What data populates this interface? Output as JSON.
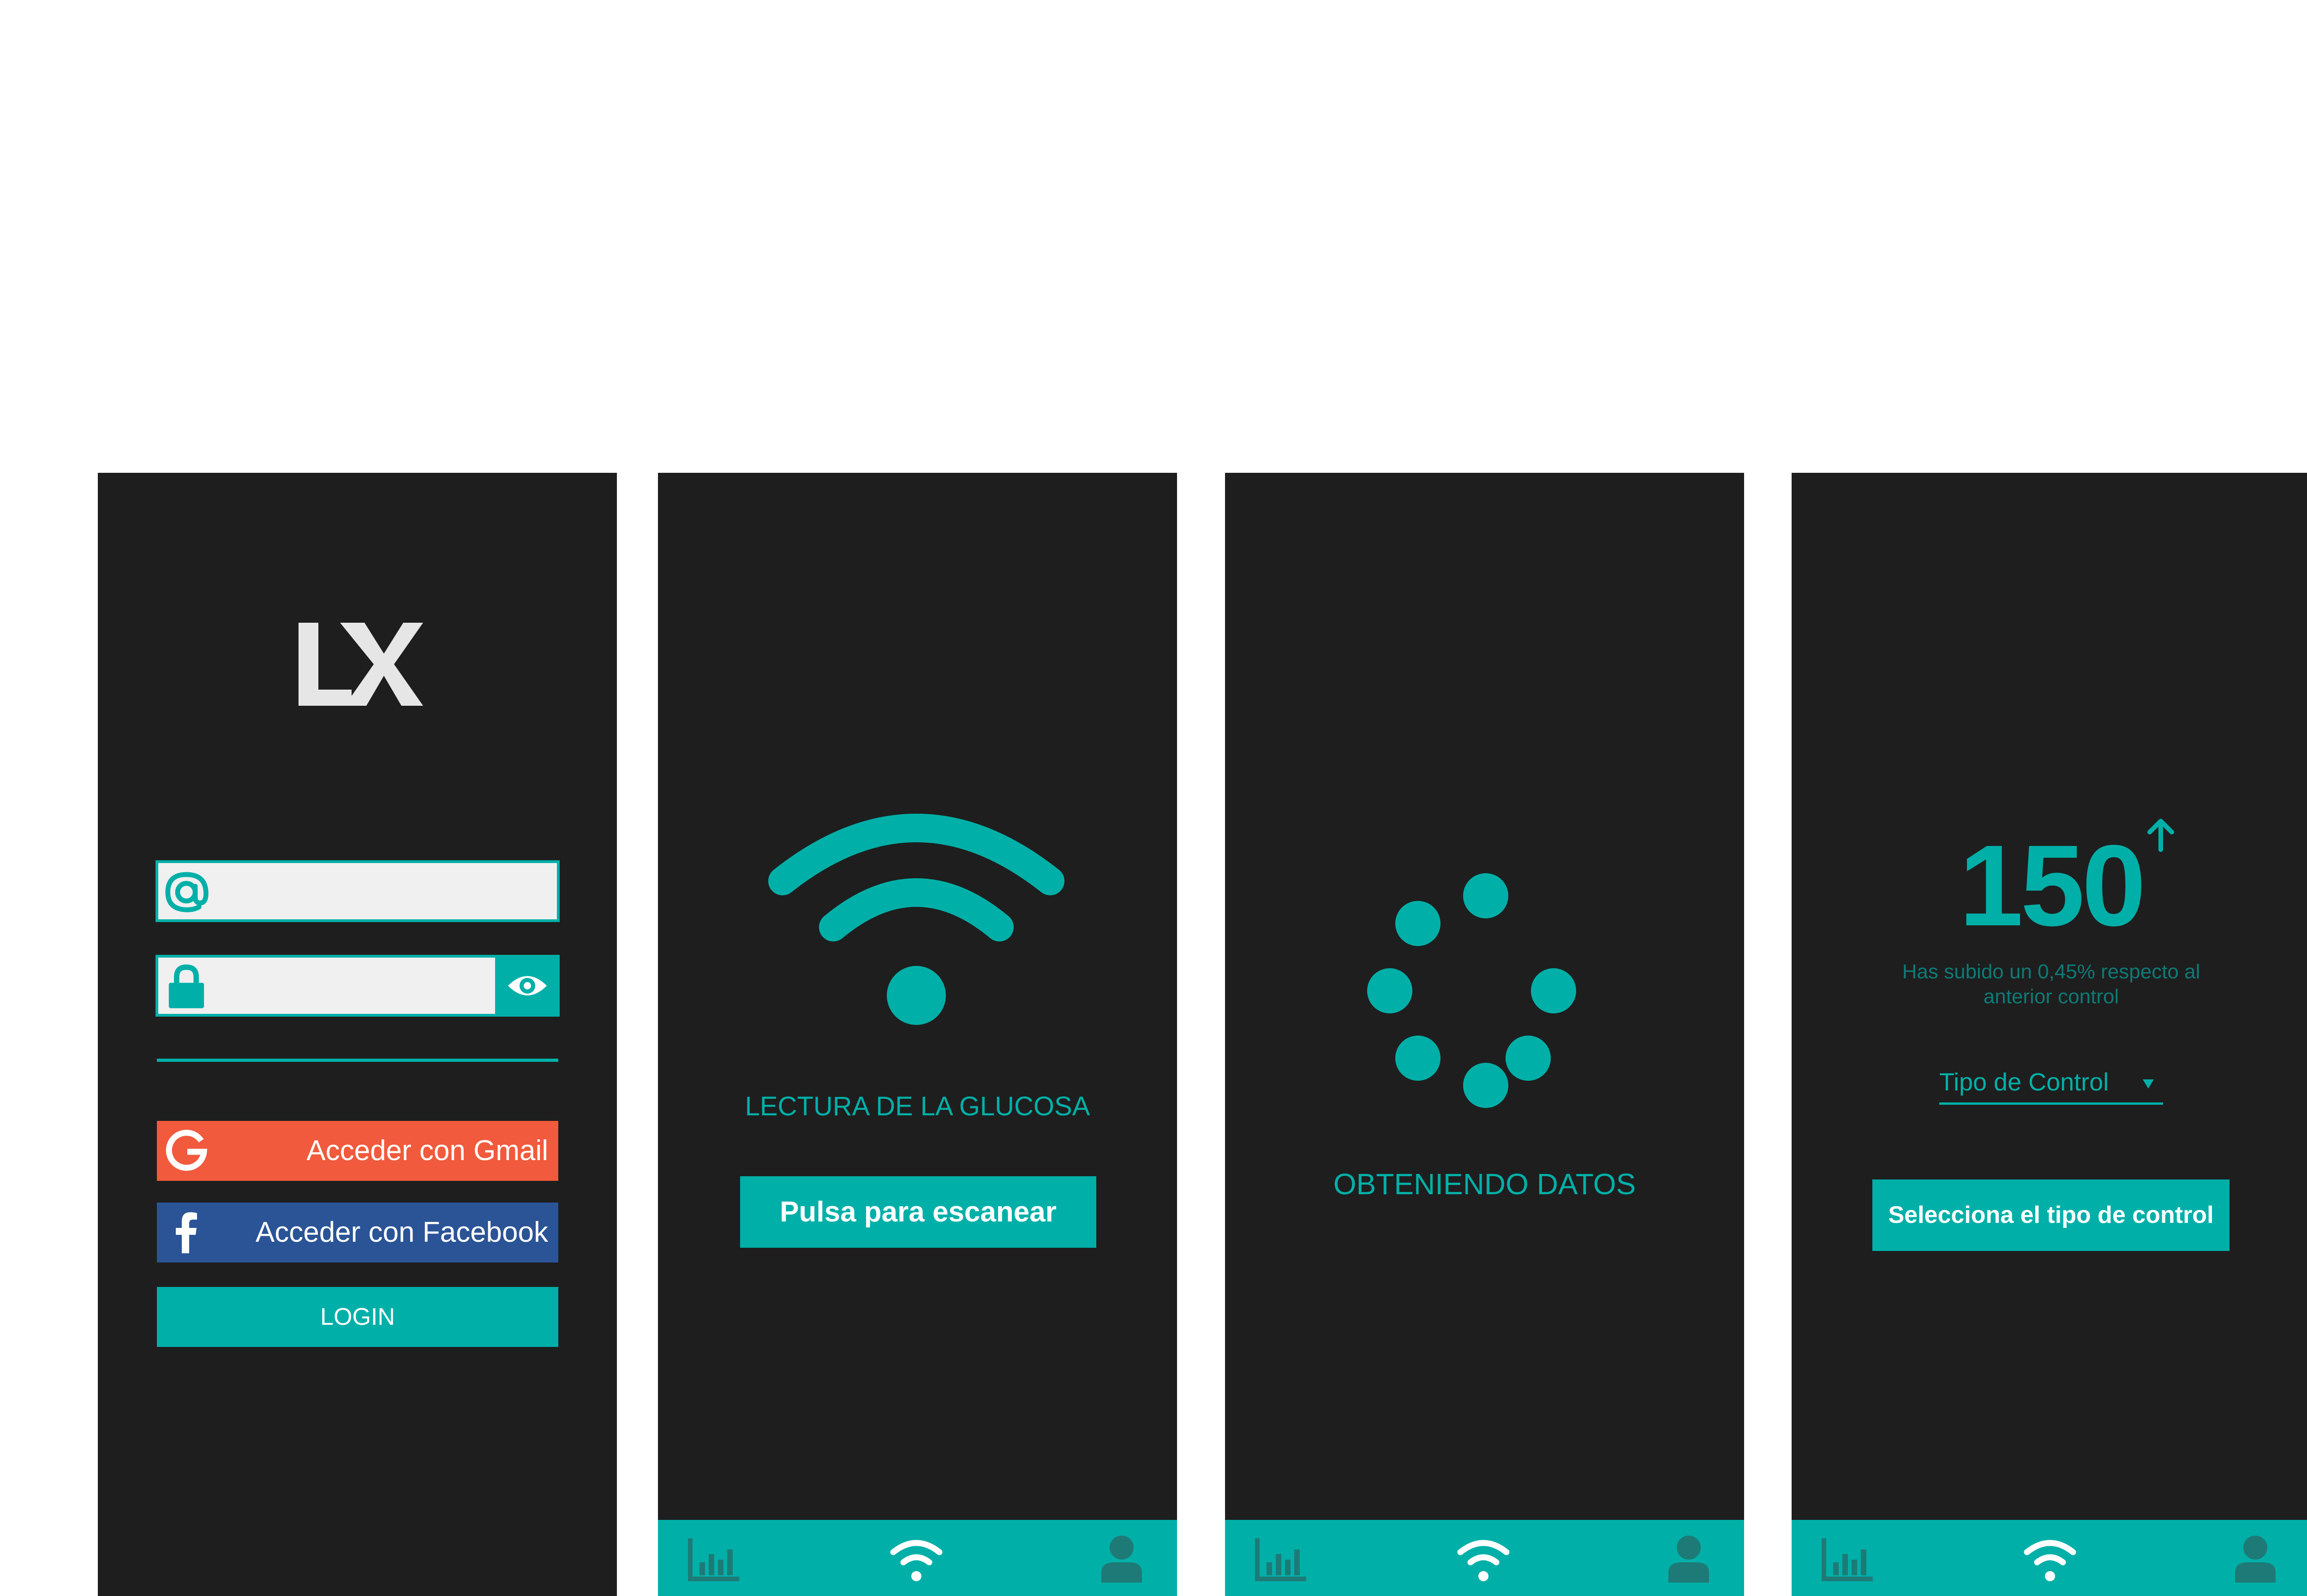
{
  "colors": {
    "background": "#1e1e1e",
    "accent": "#00b0a8",
    "gmail": "#f15a3c",
    "facebook": "#2b5496",
    "logo": "#e6e6e6",
    "muted_accent": "#0d7a76"
  },
  "login_screen": {
    "logo_text": "LX",
    "email_icon": "at-icon",
    "password_icon": "lock-icon",
    "show_password_icon": "eye-icon",
    "email_value": "",
    "password_value": "",
    "gmail_label": "Acceder con Gmail",
    "gmail_icon": "google-icon",
    "facebook_label": "Acceder con Facebook",
    "facebook_icon": "facebook-icon",
    "login_label": "LOGIN"
  },
  "scan_screen": {
    "icon": "wifi-icon",
    "title": "LECTURA DE LA GLUCOSA",
    "button_label": "Pulsa para escanear"
  },
  "loading_screen": {
    "icon": "loading-spinner-icon",
    "status": "OBTENIENDO DATOS"
  },
  "result_screen": {
    "value": "150",
    "trend_icon": "arrow-up-icon",
    "message": "Has subido un 0,45% respecto al anterior control",
    "select_value": "Tipo de Control",
    "select_icon": "triangle-down-icon",
    "button_label": "Selecciona el tipo de control"
  },
  "navbar": {
    "items": [
      {
        "icon": "bar-chart-icon"
      },
      {
        "icon": "wifi-icon"
      },
      {
        "icon": "user-icon"
      }
    ]
  }
}
